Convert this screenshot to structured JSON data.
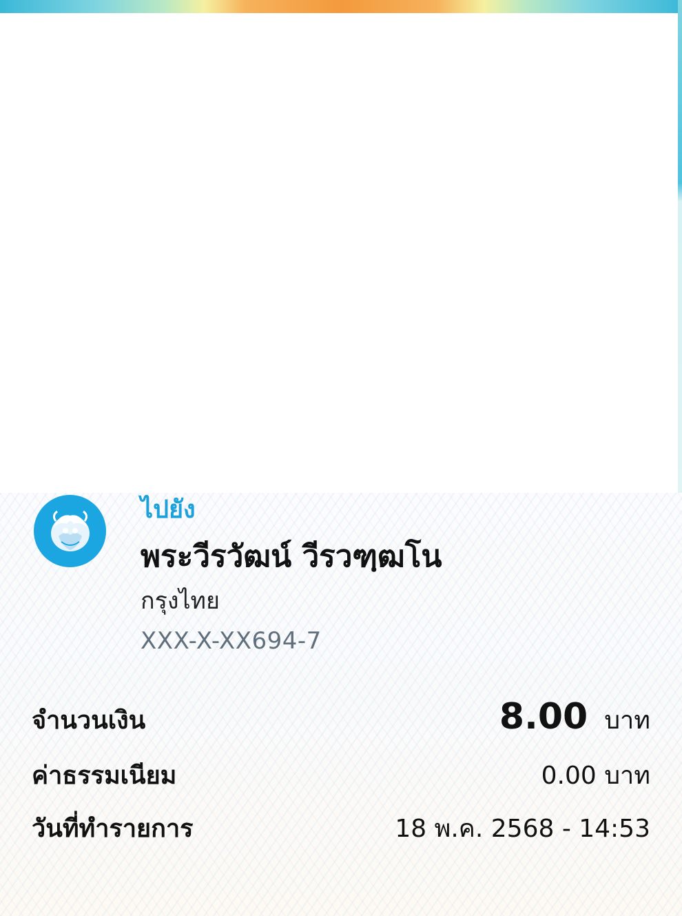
{
  "transfer": {
    "to_label": "ไปยัง",
    "recipient_name": "พระวีรวัฒน์ วีรวฑฺฒโน",
    "bank_name": "กรุงไทย",
    "account_number": "XXX-X-XX694-7",
    "bank_logo_icon": "krungthai-bank-logo-icon",
    "bank_color": "#1ba5e1"
  },
  "details": {
    "amount_label": "จำนวนเงิน",
    "amount_value": "8.00",
    "amount_currency": "บาท",
    "fee_label": "ค่าธรรมเนียม",
    "fee_value": "0.00 บาท",
    "date_label": "วันที่ทำรายการ",
    "date_value": "18 พ.ค. 2568 - 14:53"
  },
  "colors": {
    "accent": "#1da1db",
    "text": "#111111",
    "account_text": "#5f6f7c"
  }
}
